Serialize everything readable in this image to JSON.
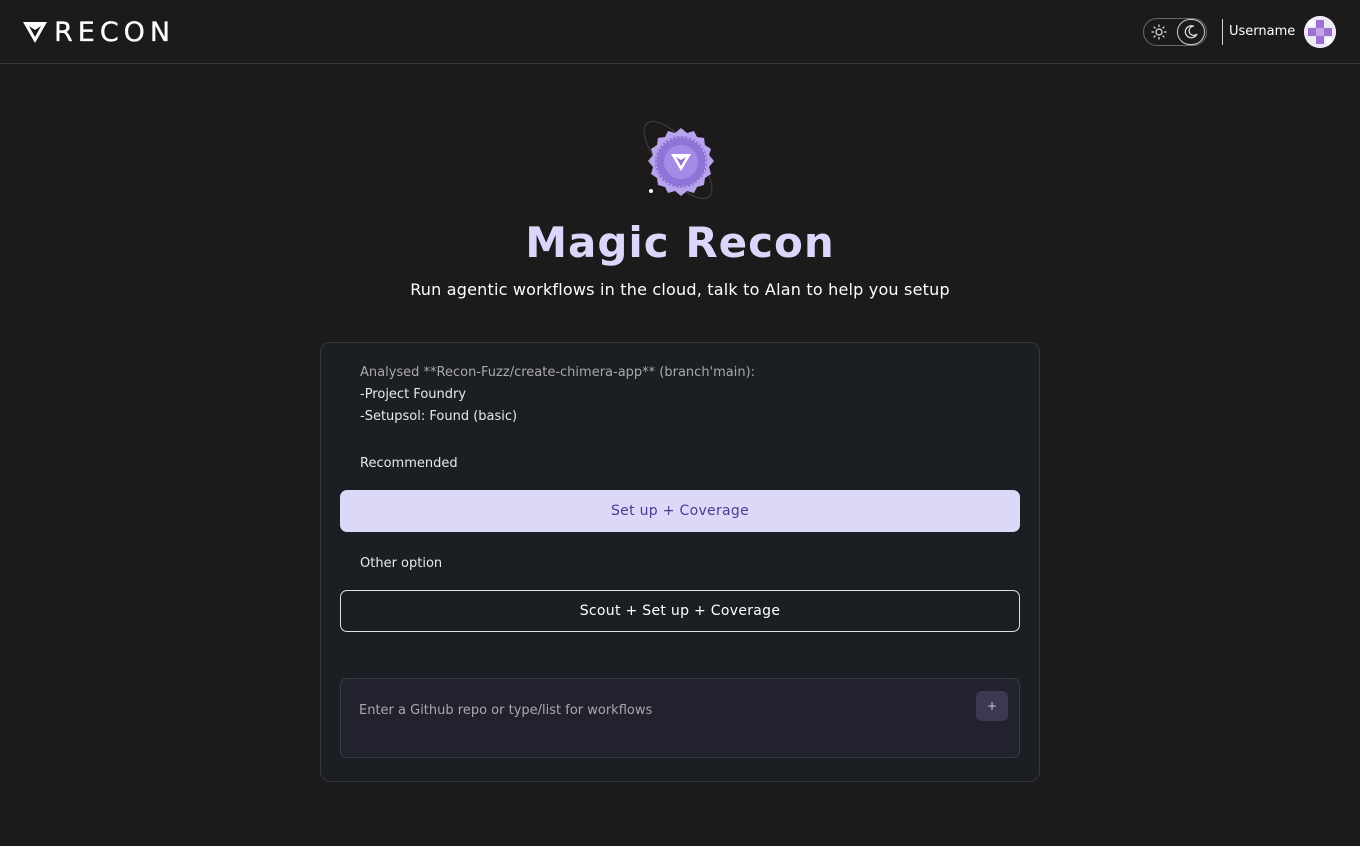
{
  "header": {
    "brand": "RECON",
    "username": "Username"
  },
  "hero": {
    "title": "Magic Recon",
    "subtitle": "Run agentic workflows in the cloud, talk to Alan to help you setup"
  },
  "analysis": {
    "summary": "Analysed **Recon-Fuzz/create-chimera-app** (branch'main):",
    "items": [
      "-Project Foundry",
      "-Setupsol: Found (basic)"
    ]
  },
  "recommended": {
    "label": "Recommended",
    "button_label": "Set up + Coverage"
  },
  "other": {
    "label": "Other option",
    "button_label": "Scout + Set up + Coverage"
  },
  "prompt": {
    "placeholder": "Enter a Github repo or type/list for workflows",
    "value": "",
    "add_label": "+"
  },
  "colors": {
    "background": "#1c1a1a",
    "accent": "#dcd8f8",
    "accent_text": "#4a3d8f",
    "title": "#dcd6fb",
    "card": "#1b1e23"
  },
  "icons": {
    "logo": "recon-logo-icon",
    "light": "sun-icon",
    "dark": "moon-icon",
    "badge": "recon-badge-icon",
    "add": "plus-icon"
  }
}
